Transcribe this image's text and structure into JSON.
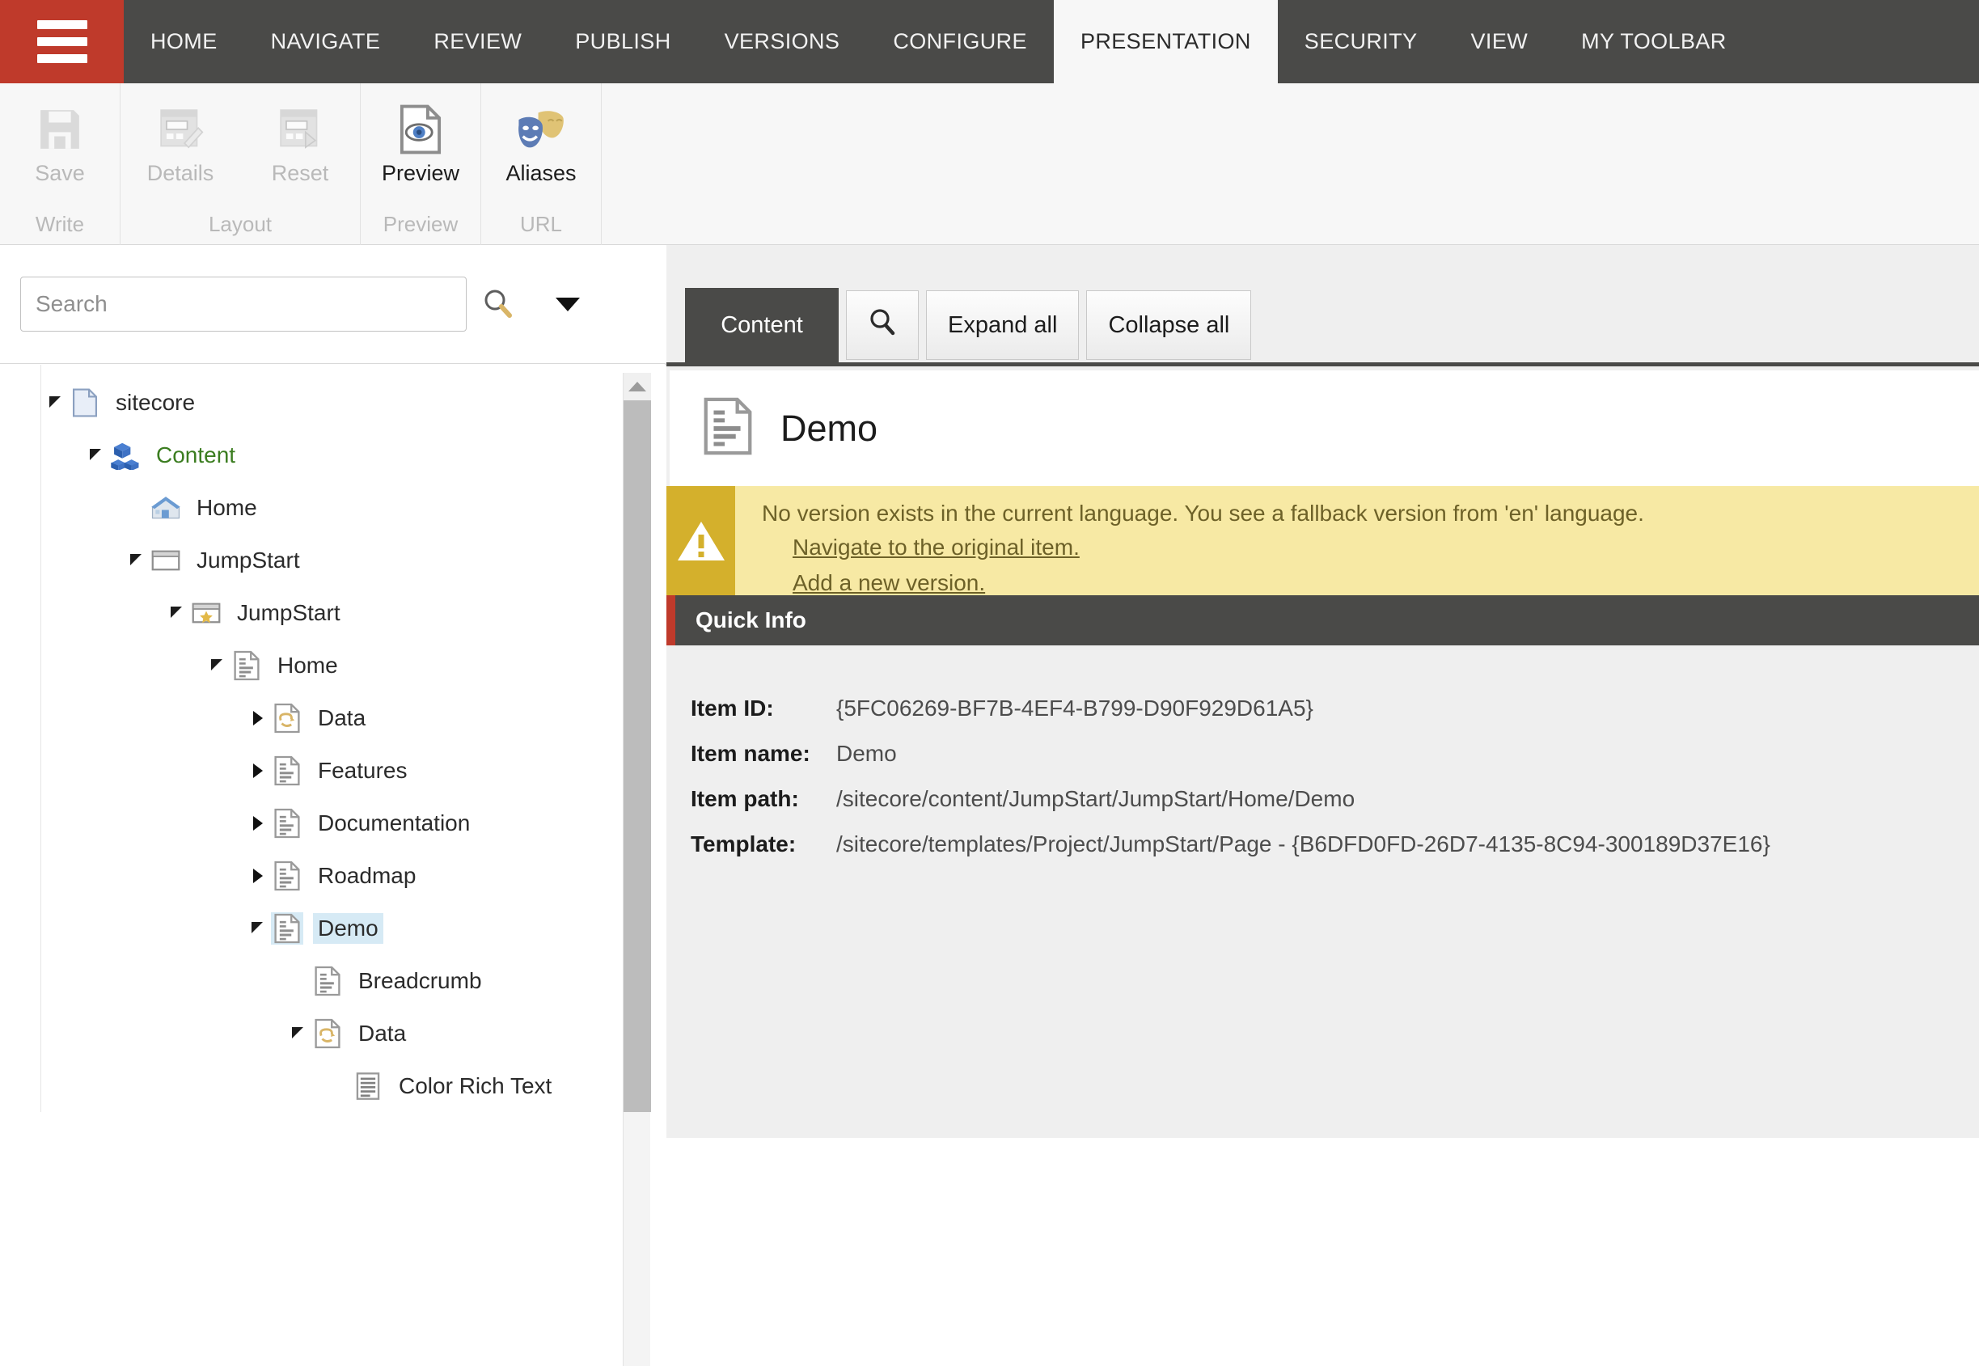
{
  "topbar": {
    "menu_icon": "hamburger-icon",
    "tabs": [
      {
        "label": "HOME",
        "active": false
      },
      {
        "label": "NAVIGATE",
        "active": false
      },
      {
        "label": "REVIEW",
        "active": false
      },
      {
        "label": "PUBLISH",
        "active": false
      },
      {
        "label": "VERSIONS",
        "active": false
      },
      {
        "label": "CONFIGURE",
        "active": false
      },
      {
        "label": "PRESENTATION",
        "active": true
      },
      {
        "label": "SECURITY",
        "active": false
      },
      {
        "label": "VIEW",
        "active": false
      },
      {
        "label": "MY TOOLBAR",
        "active": false
      }
    ]
  },
  "ribbon": {
    "groups": [
      {
        "title": "Write",
        "buttons": [
          {
            "label": "Save",
            "icon": "floppy-disk-icon",
            "disabled": true
          }
        ]
      },
      {
        "title": "Layout",
        "buttons": [
          {
            "label": "Details",
            "icon": "layout-details-icon",
            "disabled": true
          },
          {
            "label": "Reset",
            "icon": "layout-reset-icon",
            "disabled": true
          }
        ]
      },
      {
        "title": "Preview",
        "buttons": [
          {
            "label": "Preview",
            "icon": "page-preview-icon",
            "disabled": false
          }
        ]
      },
      {
        "title": "URL",
        "buttons": [
          {
            "label": "Aliases",
            "icon": "theater-masks-icon",
            "disabled": false
          }
        ]
      }
    ]
  },
  "search": {
    "placeholder": "Search",
    "value": "",
    "go_icon": "magnifier-icon",
    "caret_icon": "chevron-down-icon"
  },
  "tree": {
    "nodes": [
      {
        "label": "sitecore",
        "depth": 0,
        "state": "open",
        "icon": "document-blue-icon",
        "selected": false,
        "green": false
      },
      {
        "label": "Content",
        "depth": 1,
        "state": "open",
        "icon": "content-cubes-icon",
        "selected": false,
        "green": true
      },
      {
        "label": "Home",
        "depth": 2,
        "state": "leaf",
        "icon": "home-house-icon",
        "selected": false,
        "green": false
      },
      {
        "label": "JumpStart",
        "depth": 2,
        "state": "open",
        "icon": "window-icon",
        "selected": false,
        "green": false
      },
      {
        "label": "JumpStart",
        "depth": 3,
        "state": "open",
        "icon": "star-window-icon",
        "selected": false,
        "green": false
      },
      {
        "label": "Home",
        "depth": 4,
        "state": "open",
        "icon": "page-icon",
        "selected": false,
        "green": false
      },
      {
        "label": "Data",
        "depth": 5,
        "state": "closed",
        "icon": "data-page-icon",
        "selected": false,
        "green": false
      },
      {
        "label": "Features",
        "depth": 5,
        "state": "closed",
        "icon": "page-icon",
        "selected": false,
        "green": false
      },
      {
        "label": "Documentation",
        "depth": 5,
        "state": "closed",
        "icon": "page-icon",
        "selected": false,
        "green": false
      },
      {
        "label": "Roadmap",
        "depth": 5,
        "state": "closed",
        "icon": "page-icon",
        "selected": false,
        "green": false
      },
      {
        "label": "Demo",
        "depth": 5,
        "state": "open",
        "icon": "page-icon",
        "selected": true,
        "green": false
      },
      {
        "label": "Breadcrumb",
        "depth": 6,
        "state": "leaf",
        "icon": "page-icon",
        "selected": false,
        "green": false
      },
      {
        "label": "Data",
        "depth": 6,
        "state": "open",
        "icon": "data-page-icon",
        "selected": false,
        "green": false
      },
      {
        "label": "Color Rich Text",
        "depth": 7,
        "state": "leaf",
        "icon": "richtext-icon",
        "selected": false,
        "green": false
      }
    ]
  },
  "content": {
    "tabs": [
      {
        "label": "Content",
        "active": true
      }
    ],
    "buttons": [
      {
        "label": "",
        "icon": "magnifier-icon",
        "name": "search-button"
      },
      {
        "label": "Expand all",
        "icon": "",
        "name": "expand-all-button"
      },
      {
        "label": "Collapse all",
        "icon": "",
        "name": "collapse-all-button"
      }
    ],
    "item_title": "Demo",
    "item_icon": "page-icon",
    "warning": {
      "icon": "warning-triangle-icon",
      "message": "No version exists in the current language. You see a fallback version from 'en' language.",
      "links": [
        "Navigate to the original item.",
        "Add a new version."
      ]
    },
    "quick_info": {
      "title": "Quick Info",
      "rows": [
        {
          "label": "Item ID:",
          "value": "{5FC06269-BF7B-4EF4-B799-D90F929D61A5}"
        },
        {
          "label": "Item name:",
          "value": "Demo"
        },
        {
          "label": "Item path:",
          "value": "/sitecore/content/JumpStart/JumpStart/Home/Demo"
        },
        {
          "label": "Template:",
          "value": "/sitecore/templates/Project/JumpStart/Page - {B6DFD0FD-26D7-4135-8C94-300189D37E16}"
        }
      ]
    }
  },
  "colors": {
    "accent_red": "#bf3a2b",
    "dark_chrome": "#4a4a48",
    "warning_bg": "#f7e9a4",
    "warning_icon_bg": "#d4b02c",
    "selection_blue": "#d6eaf5",
    "green_text": "#3b7d20"
  }
}
